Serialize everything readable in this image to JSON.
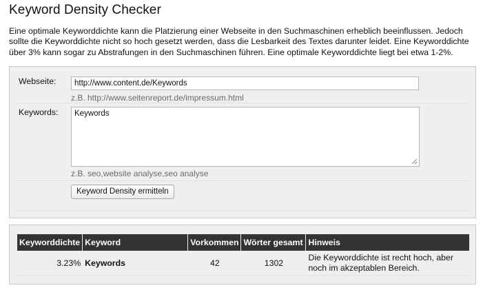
{
  "page": {
    "title": "Keyword Density Checker",
    "intro": "Eine optimale Keyworddichte kann die Platzierung einer Webseite in den Suchmaschinen erheblich beeinflussen. Jedoch sollte die Keyworddichte nicht so hoch gesetzt werden, dass die Lesbarkeit des Textes darunter leidet. Eine Keyworddichte über 3% kann sogar zu Abstrafungen in den Suchmaschinen führen. Eine optimale Keyworddichte liegt bei etwa 1-2%."
  },
  "form": {
    "website_label": "Webseite:",
    "website_value": "http://www.content.de/Keywords",
    "website_hint": "z.B. http://www.seitenreport.de/impressum.html",
    "keywords_label": "Keywords:",
    "keywords_value": "Keywords",
    "keywords_hint": "z.B. seo,website analyse,seo analyse",
    "submit_label": "Keyword Density ermitteln"
  },
  "results": {
    "columns": [
      "Keyworddichte",
      "Keyword",
      "Vorkommen",
      "Wörter gesamt",
      "Hinweis"
    ],
    "rows": [
      {
        "density": "3.23%",
        "keyword": "Keywords",
        "occurrences": "42",
        "total_words": "1302",
        "hint": "Die Keyworddichte ist recht hoch, aber noch im akzeptablen Bereich."
      }
    ]
  },
  "colors": {
    "panel_bg": "#efefef",
    "header_bg": "#333333",
    "header_text": "#ffffff",
    "hint_text": "#6a6a6a"
  }
}
